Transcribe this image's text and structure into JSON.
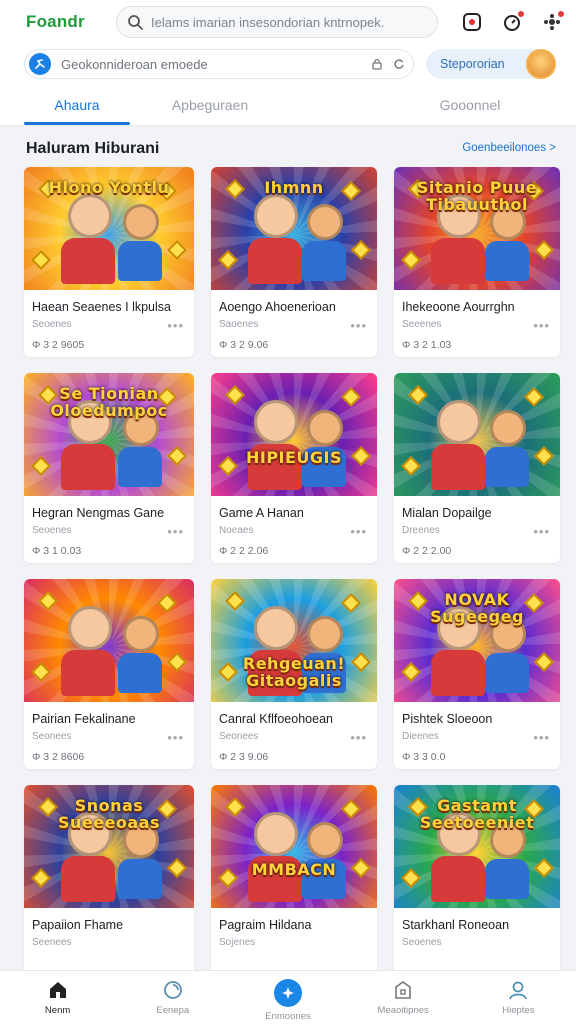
{
  "app": {
    "brand": "Foandr",
    "brand_color": "#1f9d3a",
    "accent": "#1976d2"
  },
  "search": {
    "placeholder": "Ιelams imarian insesondorian kntrnopek."
  },
  "header_icons": [
    "camera-icon",
    "timer-icon",
    "notification-icon"
  ],
  "subbar": {
    "url_placeholder": "Geokonnideroan emoede",
    "pill_label": "Stepororian"
  },
  "tabs": [
    {
      "label": "Ahaura",
      "active": true
    },
    {
      "label": "Apbeguraen",
      "active": false
    },
    {
      "label": "Gooonnel",
      "active": false
    }
  ],
  "section": {
    "title": "Haluram Hiburani",
    "link": "Goenbeeilonoes >"
  },
  "cards": [
    {
      "title": "Haean Seaenes I lkpulsa",
      "sub": "Seoenes",
      "price": "Φ 3 2 9605",
      "banner": "Hlono Yontlu",
      "palette": [
        "#ffcb2e",
        "#f07b1e",
        "#3aa0e8"
      ]
    },
    {
      "title": "Aoengo Ahoenerioan",
      "sub": "Saoenes",
      "price": "Φ 3 2 9.06",
      "banner": "Ihmnn",
      "palette": [
        "#2a3fa8",
        "#d4422f",
        "#35b0e0"
      ]
    },
    {
      "title": "Ihekeoone Aourrghn",
      "sub": "Seeenes",
      "price": "Φ 3 2 1.03",
      "banner": "Sitanio Puue Tibauuthol",
      "palette": [
        "#e2432c",
        "#6b2fb8",
        "#f5a623"
      ]
    },
    {
      "title": "Hegran Nengmas Gane",
      "sub": "Seoenes",
      "price": "Φ 3 1 0.03",
      "banner": "Se Tionian Oloedumpoc",
      "palette": [
        "#b44bd1",
        "#ffb21e",
        "#36a84a"
      ]
    },
    {
      "title": "Game A Hanan",
      "sub": "Noeaes",
      "price": "Φ 2 2 2.06",
      "banner": "HIPIEUGIS",
      "palette": [
        "#6a1fb0",
        "#ff3d8b",
        "#ffc629"
      ]
    },
    {
      "title": "Mialan Dopailge",
      "sub": "Dreenes",
      "price": "Φ 2 2 2.00",
      "banner": "",
      "palette": [
        "#1b6f7a",
        "#2e9e5a",
        "#f2c04a"
      ]
    },
    {
      "title": "Pairian Fekalinane",
      "sub": "Seonees",
      "price": "Φ 3 2 8606",
      "banner": "",
      "palette": [
        "#ff8a00",
        "#d92b63",
        "#7a2fd0"
      ]
    },
    {
      "title": "Canral Kflfoeohoean",
      "sub": "Seonees",
      "price": "Φ 2 3 9.06",
      "banner": "Rehgeuan! Gitaogalis",
      "palette": [
        "#1a9ee0",
        "#ffd23a",
        "#e54b2a"
      ]
    },
    {
      "title": "Pishtek Sloeoon",
      "sub": "Dieenes",
      "price": "Φ 3 3 0.0",
      "banner": "NOVAK Sugeegeg",
      "palette": [
        "#5a2bd1",
        "#ff4f8a",
        "#ffb21e"
      ]
    },
    {
      "title": "Papaiion Fhame",
      "sub": "Seenees",
      "price": "",
      "banner": "Snonas Sueeeoaas",
      "palette": [
        "#2c3f9e",
        "#e14f2c",
        "#f4c02a"
      ]
    },
    {
      "title": "Pagraim Hildana",
      "sub": "Sojenes",
      "price": "",
      "banner": "MMBACN",
      "palette": [
        "#7b22c9",
        "#ff7a00",
        "#2bb7e6"
      ]
    },
    {
      "title": "Starkhanl Roneoan",
      "sub": "Seoenes",
      "price": "",
      "banner": "Gastamt Seetoeeniet",
      "palette": [
        "#2aa84a",
        "#1b7fd6",
        "#ffd02a"
      ]
    }
  ],
  "bottom_nav": [
    {
      "label": "Nenm",
      "icon": "home-icon",
      "active": true
    },
    {
      "label": "Eenepa",
      "icon": "search-icon",
      "active": false
    },
    {
      "label": "Enmoones",
      "icon": "star-icon",
      "active": false
    },
    {
      "label": "Meaoitipnes",
      "icon": "bag-icon",
      "active": false
    },
    {
      "label": "Hieptes",
      "icon": "profile-icon",
      "active": false
    }
  ]
}
